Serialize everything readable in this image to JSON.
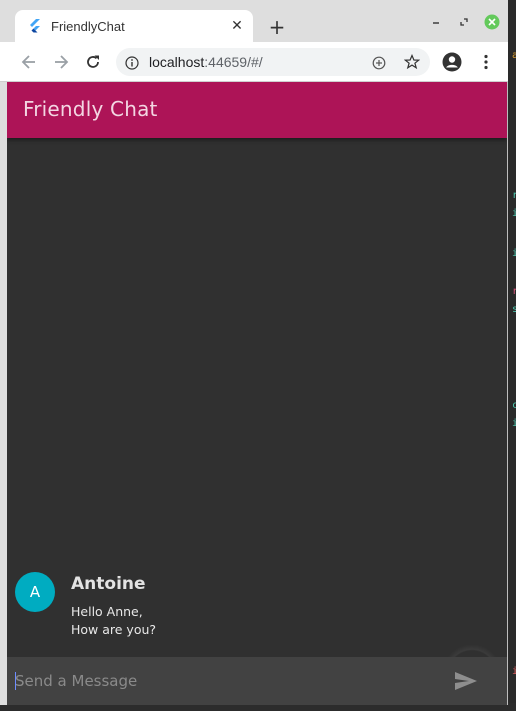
{
  "browser": {
    "tab_title": "FriendlyChat",
    "new_tab_label": "+",
    "url_host": "localhost",
    "url_rest": ":44659/#/"
  },
  "app": {
    "title": "Friendly Chat",
    "accent_color": "#ad1457",
    "messages": [
      {
        "avatar_initial": "A",
        "sender": "Antoine",
        "lines": [
          "Hello Anne,",
          "How are you?"
        ]
      }
    ],
    "composer": {
      "placeholder": "Send a Message"
    }
  },
  "icons": {
    "tab_favicon": "flutter-icon",
    "back": "arrow-left-icon",
    "forward": "arrow-right-icon",
    "reload": "reload-icon",
    "site_info": "info-icon",
    "install": "add-circle-icon",
    "bookmark": "star-icon",
    "profile": "account-circle-icon",
    "menu": "more-vert-icon",
    "send": "send-icon"
  }
}
